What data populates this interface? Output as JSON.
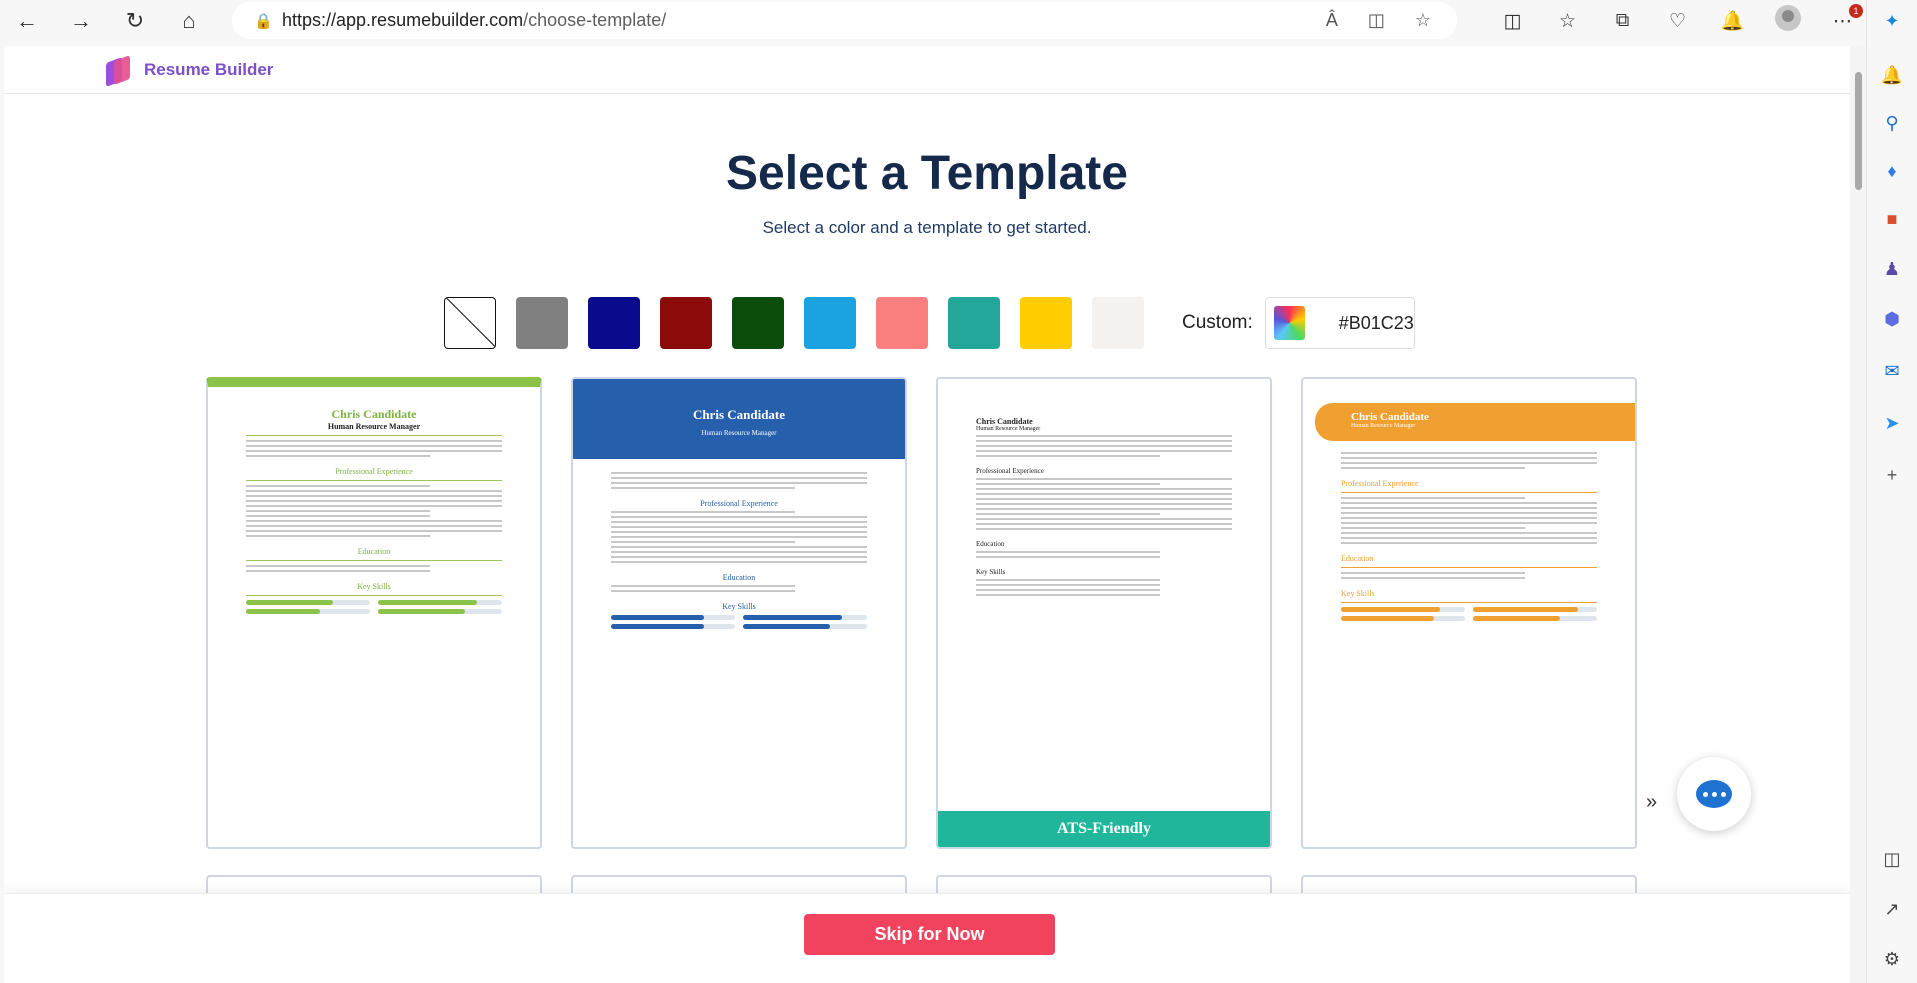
{
  "browser": {
    "url_host": "https://app.resumebuilder.com",
    "url_path": "/choose-template/",
    "notification_count": "1"
  },
  "header": {
    "brand": "Resume Builder"
  },
  "main": {
    "title": "Select a Template",
    "subtitle": "Select a color and a template to get started.",
    "custom_label": "Custom:",
    "custom_value": "#B01C23",
    "swatches": [
      "none",
      "#808080",
      "#0a0a8c",
      "#8b0a0a",
      "#0a4d0a",
      "#1aa3e0",
      "#fa7f7f",
      "#22a79a",
      "#ffcd00",
      "#f4f1ee"
    ]
  },
  "templates": [
    {
      "name": "Chris Candidate",
      "role": "Human Resource Manager",
      "sections": [
        "Professional Experience",
        "Education",
        "Key Skills"
      ],
      "accent": "#8bc34a"
    },
    {
      "name": "Chris Candidate",
      "role": "Human Resource Manager",
      "sections": [
        "Professional Experience",
        "Education",
        "Key Skills"
      ],
      "accent": "#2660ad"
    },
    {
      "name": "Chris Candidate",
      "role": "Human Resource Manager",
      "sections": [
        "Professional Experience",
        "Education",
        "Key Skills"
      ],
      "badge": "ATS-Friendly"
    },
    {
      "name": "Chris Candidate",
      "role": "Human Resource Manager",
      "sections": [
        "Professional Experience",
        "Education",
        "Key Skills"
      ],
      "accent": "#f0a030"
    }
  ],
  "footer": {
    "skip_label": "Skip for Now"
  }
}
